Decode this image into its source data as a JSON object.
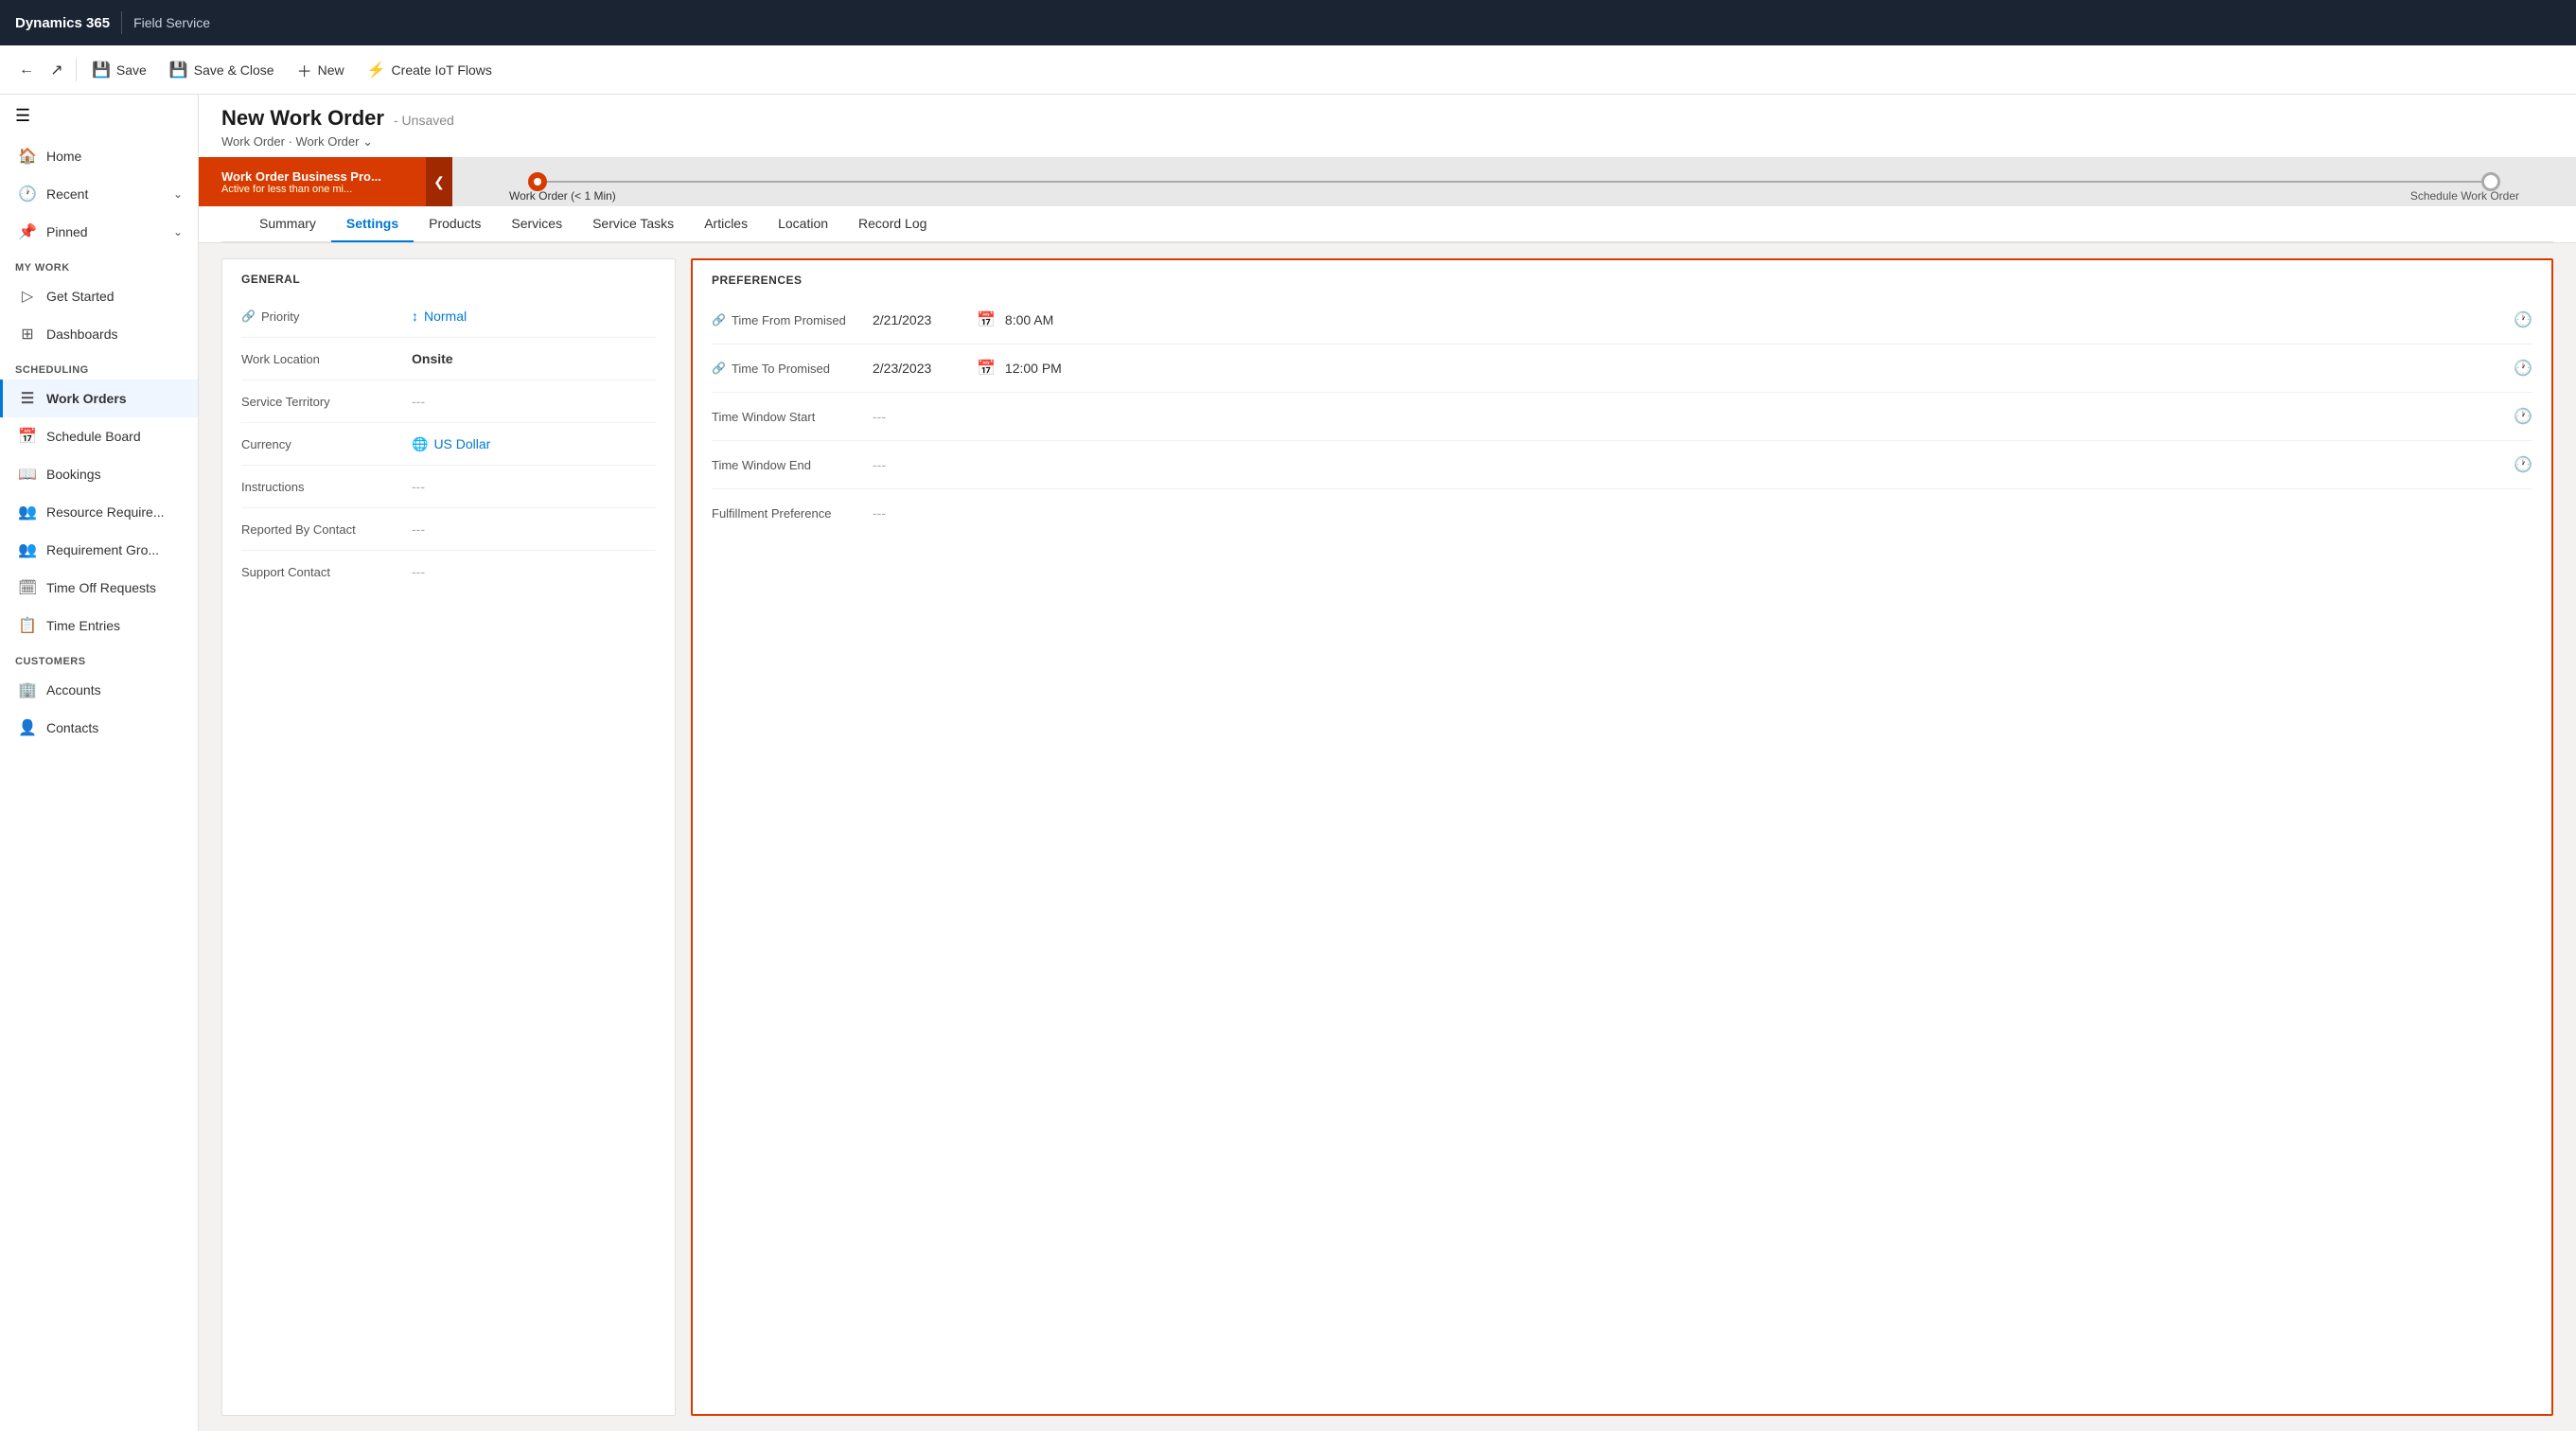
{
  "topbar": {
    "app_name": "Dynamics 365",
    "module_name": "Field Service"
  },
  "commandbar": {
    "save_label": "Save",
    "save_close_label": "Save & Close",
    "new_label": "New",
    "create_iot_label": "Create IoT Flows"
  },
  "sidebar": {
    "sections": [
      {
        "label": "My Work",
        "items": [
          {
            "id": "get-started",
            "label": "Get Started",
            "icon": "▷"
          },
          {
            "id": "dashboards",
            "label": "Dashboards",
            "icon": "⊞"
          }
        ]
      },
      {
        "label": "Scheduling",
        "items": [
          {
            "id": "work-orders",
            "label": "Work Orders",
            "icon": "☰",
            "active": true
          },
          {
            "id": "schedule-board",
            "label": "Schedule Board",
            "icon": "📅"
          },
          {
            "id": "bookings",
            "label": "Bookings",
            "icon": "👤"
          },
          {
            "id": "resource-require",
            "label": "Resource Require...",
            "icon": "👥"
          },
          {
            "id": "requirement-gro",
            "label": "Requirement Gro...",
            "icon": "👥"
          },
          {
            "id": "time-off-requests",
            "label": "Time Off Requests",
            "icon": "🗓"
          },
          {
            "id": "time-entries",
            "label": "Time Entries",
            "icon": "📋"
          }
        ]
      },
      {
        "label": "Customers",
        "items": [
          {
            "id": "accounts",
            "label": "Accounts",
            "icon": "🏢"
          },
          {
            "id": "contacts",
            "label": "Contacts",
            "icon": "👤"
          }
        ]
      }
    ]
  },
  "page": {
    "title": "New Work Order",
    "status": "Unsaved",
    "breadcrumb1": "Work Order",
    "breadcrumb2": "Work Order"
  },
  "progress": {
    "stage1_title": "Work Order Business Pro...",
    "stage1_sub": "Active for less than one mi...",
    "stage2_label": "Work Order (< 1 Min)",
    "stage3_label": "Schedule Work Order"
  },
  "tabs": [
    {
      "id": "summary",
      "label": "Summary"
    },
    {
      "id": "settings",
      "label": "Settings",
      "active": true
    },
    {
      "id": "products",
      "label": "Products"
    },
    {
      "id": "services",
      "label": "Services"
    },
    {
      "id": "service-tasks",
      "label": "Service Tasks"
    },
    {
      "id": "articles",
      "label": "Articles"
    },
    {
      "id": "location",
      "label": "Location"
    },
    {
      "id": "record-log",
      "label": "Record Log"
    }
  ],
  "general": {
    "section_title": "GENERAL",
    "fields": [
      {
        "id": "priority",
        "label": "Priority",
        "value": "Normal",
        "type": "link",
        "has_lock": true
      },
      {
        "id": "work-location",
        "label": "Work Location",
        "value": "Onsite",
        "type": "bold"
      },
      {
        "id": "service-territory",
        "label": "Service Territory",
        "value": "---",
        "type": "empty"
      },
      {
        "id": "currency",
        "label": "Currency",
        "value": "US Dollar",
        "type": "link"
      },
      {
        "id": "instructions",
        "label": "Instructions",
        "value": "---",
        "type": "empty"
      },
      {
        "id": "reported-by-contact",
        "label": "Reported By Contact",
        "value": "---",
        "type": "empty"
      },
      {
        "id": "support-contact",
        "label": "Support Contact",
        "value": "---",
        "type": "empty"
      }
    ]
  },
  "preferences": {
    "section_title": "PREFERENCES",
    "rows": [
      {
        "id": "time-from-promised",
        "label": "Time From Promised",
        "date": "2/21/2023",
        "time": "8:00 AM",
        "has_lock": true
      },
      {
        "id": "time-to-promised",
        "label": "Time To Promised",
        "date": "2/23/2023",
        "time": "12:00 PM",
        "has_lock": true
      },
      {
        "id": "time-window-start",
        "label": "Time Window Start",
        "date": "---",
        "time": "",
        "has_lock": false
      },
      {
        "id": "time-window-end",
        "label": "Time Window End",
        "date": "---",
        "time": "",
        "has_lock": false
      }
    ],
    "fulfillment_label": "Fulfillment Preference",
    "fulfillment_value": "---"
  }
}
